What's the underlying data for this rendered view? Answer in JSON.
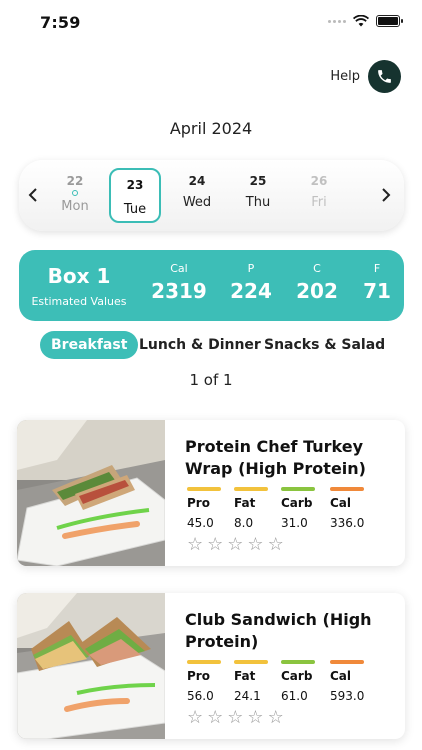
{
  "status_bar": {
    "time": "7:59"
  },
  "help": {
    "label": "Help"
  },
  "month": "April 2024",
  "date_strip": {
    "days": [
      {
        "num": "22",
        "name": "Mon"
      },
      {
        "num": "23",
        "name": "Tue"
      },
      {
        "num": "24",
        "name": "Wed"
      },
      {
        "num": "25",
        "name": "Thu"
      },
      {
        "num": "26",
        "name": "Fri"
      }
    ]
  },
  "box": {
    "title": "Box 1",
    "subtitle": "Estimated Values",
    "macros": [
      {
        "label": "Cal",
        "value": "2319"
      },
      {
        "label": "P",
        "value": "224"
      },
      {
        "label": "C",
        "value": "202"
      },
      {
        "label": "F",
        "value": "71"
      }
    ]
  },
  "tabs": [
    "Breakfast",
    "Lunch & Dinner",
    "Snacks & Salad"
  ],
  "pager": "1 of 1",
  "macro_colors": {
    "pro": "#f2c23c",
    "fat": "#f2c23c",
    "carb": "#8ac43f",
    "cal": "#f0893a"
  },
  "accent_color": "#3dbeb7",
  "meals": [
    {
      "name": "Protein Chef Turkey Wrap (High Protein)",
      "macros": [
        {
          "label": "Pro",
          "value": "45.0"
        },
        {
          "label": "Fat",
          "value": "8.0"
        },
        {
          "label": "Carb",
          "value": "31.0"
        },
        {
          "label": "Cal",
          "value": "336.0"
        }
      ],
      "rating": 0
    },
    {
      "name": "Club Sandwich (High Protein)",
      "macros": [
        {
          "label": "Pro",
          "value": "56.0"
        },
        {
          "label": "Fat",
          "value": "24.1"
        },
        {
          "label": "Carb",
          "value": "61.0"
        },
        {
          "label": "Cal",
          "value": "593.0"
        }
      ],
      "rating": 0
    }
  ]
}
